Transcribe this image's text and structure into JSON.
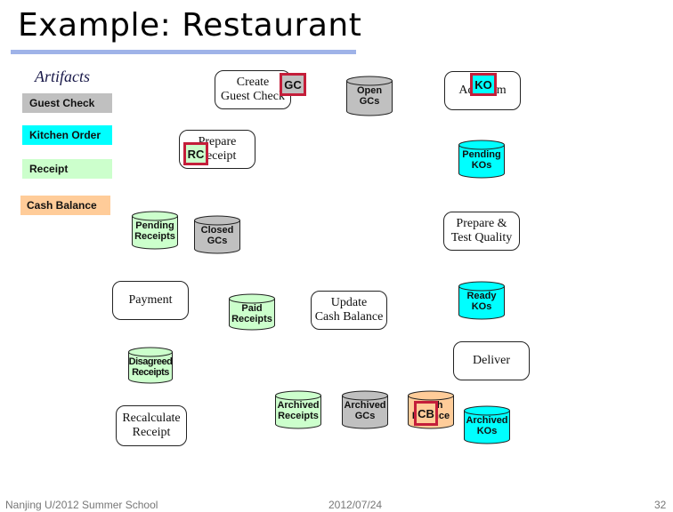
{
  "slide": {
    "title": "Example: Restaurant",
    "artifacts_heading": "Artifacts",
    "legend": [
      {
        "label": "Guest Check",
        "color": "#c0c0c0"
      },
      {
        "label": "Kitchen Order",
        "color": "#00ffff"
      },
      {
        "label": "Receipt",
        "color": "#ccffcc"
      },
      {
        "label": "Cash Balance",
        "color": "#ffcc99"
      }
    ],
    "processes": {
      "create_guest_check": "Create\nGuest Check",
      "prepare_receipt": "Prepare\nReceipt",
      "add_item": "Add Item",
      "prepare_test_quality": "Prepare &\nTest Quality",
      "payment": "Payment",
      "update_cash_balance": "Update\nCash Balance",
      "deliver": "Deliver",
      "recalculate_receipt": "Recalculate\nReceipt"
    },
    "repositories": {
      "open_gcs": "Open\nGCs",
      "pending_kos": "Pending\nKOs",
      "pending_receipts": "Pending\nReceipts",
      "closed_gcs": "Closed\nGCs",
      "ready_kos": "Ready\nKOs",
      "paid_receipts": "Paid\nReceipts",
      "disagreed_receipts": "Disagreed\nReceipts",
      "archived_receipts": "Archived\nReceipts",
      "archived_gcs": "Archived\nGCs",
      "cash_balance": "Cash\nBalance",
      "archived_kos": "Archived\nKOs"
    },
    "tags": {
      "gc": "GC",
      "rc": "RC",
      "ko": "KO",
      "cb": "CB"
    },
    "colors": {
      "guest_check": "#c0c0c0",
      "kitchen_order": "#00ffff",
      "receipt": "#ccffcc",
      "cash_balance": "#ffcc99",
      "tag_border": "#c41e3a",
      "title_rule": "#9fb3e8"
    },
    "footer": {
      "left": "Nanjing U/2012 Summer School",
      "center": "2012/07/24",
      "page": "32"
    }
  }
}
